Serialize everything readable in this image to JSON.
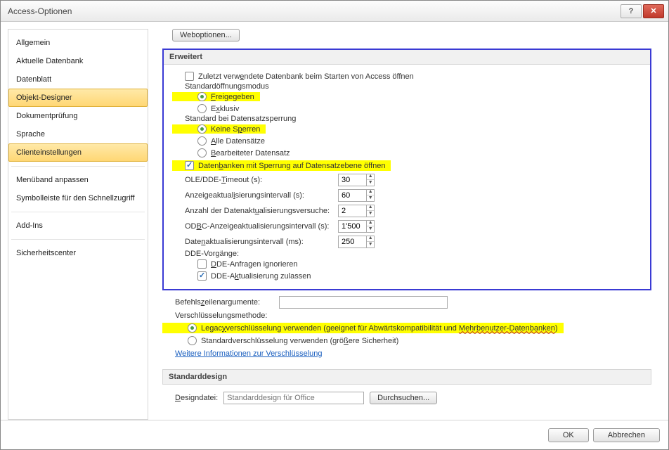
{
  "window": {
    "title": "Access-Optionen"
  },
  "sidebar": {
    "items": [
      {
        "label": "Allgemein"
      },
      {
        "label": "Aktuelle Datenbank"
      },
      {
        "label": "Datenblatt"
      },
      {
        "label": "Objekt-Designer"
      },
      {
        "label": "Dokumentprüfung"
      },
      {
        "label": "Sprache"
      },
      {
        "label": "Clienteinstellungen"
      },
      {
        "label": "Menüband anpassen"
      },
      {
        "label": "Symbolleiste für den Schnellzugriff"
      },
      {
        "label": "Add-Ins"
      },
      {
        "label": "Sicherheitscenter"
      }
    ]
  },
  "content": {
    "weboptionenBtn": "Weboptionen...",
    "groupErweitert": "Erweitert",
    "openLastDb": "Zuletzt verwendete Datenbank beim Starten von Access öffnen",
    "stdOpenMode": "Standardöffnungsmodus",
    "freigegeben": "Freigegeben",
    "exklusiv": "Exklusiv",
    "stdLock": "Standard bei Datensatzsperrung",
    "keineSperren": "Keine Sperren",
    "alleDatensaetze": "Alle Datensätze",
    "bearbDatensatz": "Bearbeiteter Datensatz",
    "openDbRowLock": "Datenbanken mit Sperrung auf Datensatzebene öffnen",
    "oleTimeoutLbl": "OLE/DDE-Timeout (s):",
    "oleTimeoutVal": "30",
    "anzIntvLbl": "Anzeigeaktualisierungsintervall (s):",
    "anzIntvVal": "60",
    "anzRetryLbl": "Anzahl der Datenaktualisierungsversuche:",
    "anzRetryVal": "2",
    "odbcIntvLbl": "ODBC-Anzeigeaktualisierungsintervall (s):",
    "odbcIntvVal": "1'500",
    "dataIntvLbl": "Datenaktualisierungsintervall (ms):",
    "dataIntvVal": "250",
    "ddeOps": "DDE-Vorgänge:",
    "ddeIgnore": "DDE-Anfragen ignorieren",
    "ddeAllow": "DDE-Aktualisierung zulassen",
    "cmdLineArgs": "Befehlszeilenargumente:",
    "encMethod": "Verschlüsselungsmethode:",
    "encLegacyPre": "Legacyverschlüsselung verwenden (geeignet für Abwärtskompatibilität und ",
    "encLegacyUnd": "Mehrbenutzer-Datenbanken",
    "encLegacyPost": ")",
    "encStd": "Standardverschlüsselung verwenden (größere Sicherheit)",
    "encLink": "Weitere Informationen zur Verschlüsselung",
    "groupDesign": "Standarddesign",
    "designFileLbl": "Designdatei:",
    "designFilePh": "Standarddesign für Office",
    "browseBtn": "Durchsuchen..."
  },
  "footer": {
    "ok": "OK",
    "cancel": "Abbrechen"
  }
}
